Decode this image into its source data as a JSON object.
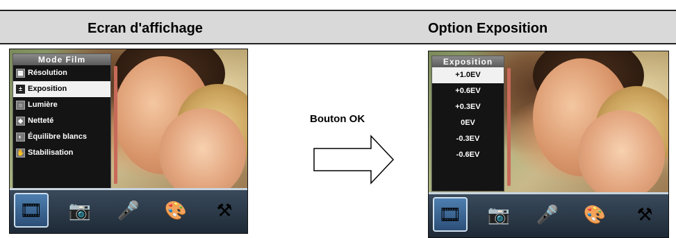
{
  "headers": {
    "left": "Ecran d'affichage",
    "right": "Option Exposition"
  },
  "arrow_label": "Bouton OK",
  "left_screen": {
    "menu_title": "Mode Film",
    "items": [
      {
        "label": "Résolution",
        "icon": "resolution-icon"
      },
      {
        "label": "Exposition",
        "icon": "exposure-icon"
      },
      {
        "label": "Lumière",
        "icon": "light-icon"
      },
      {
        "label": "Netteté",
        "icon": "sharpness-icon"
      },
      {
        "label": "Équilibre blancs",
        "icon": "white-balance-icon"
      },
      {
        "label": "Stabilisation",
        "icon": "stabilization-icon"
      }
    ],
    "selected_index": 1
  },
  "right_screen": {
    "menu_title": "Exposition",
    "items": [
      "+1.0EV",
      "+0.6EV",
      "+0.3EV",
      "0EV",
      "-0.3EV",
      "-0.6EV"
    ],
    "selected_index": 0
  },
  "toolbar_icons": [
    "movie-reel-icon",
    "camera-photo-icon",
    "microphone-icon",
    "palette-icon",
    "tools-icon"
  ],
  "colors": {
    "header_bg": "#d9d9d9",
    "selection_bg": "#f1f1f1",
    "scrollbar": "#c86a5a"
  }
}
